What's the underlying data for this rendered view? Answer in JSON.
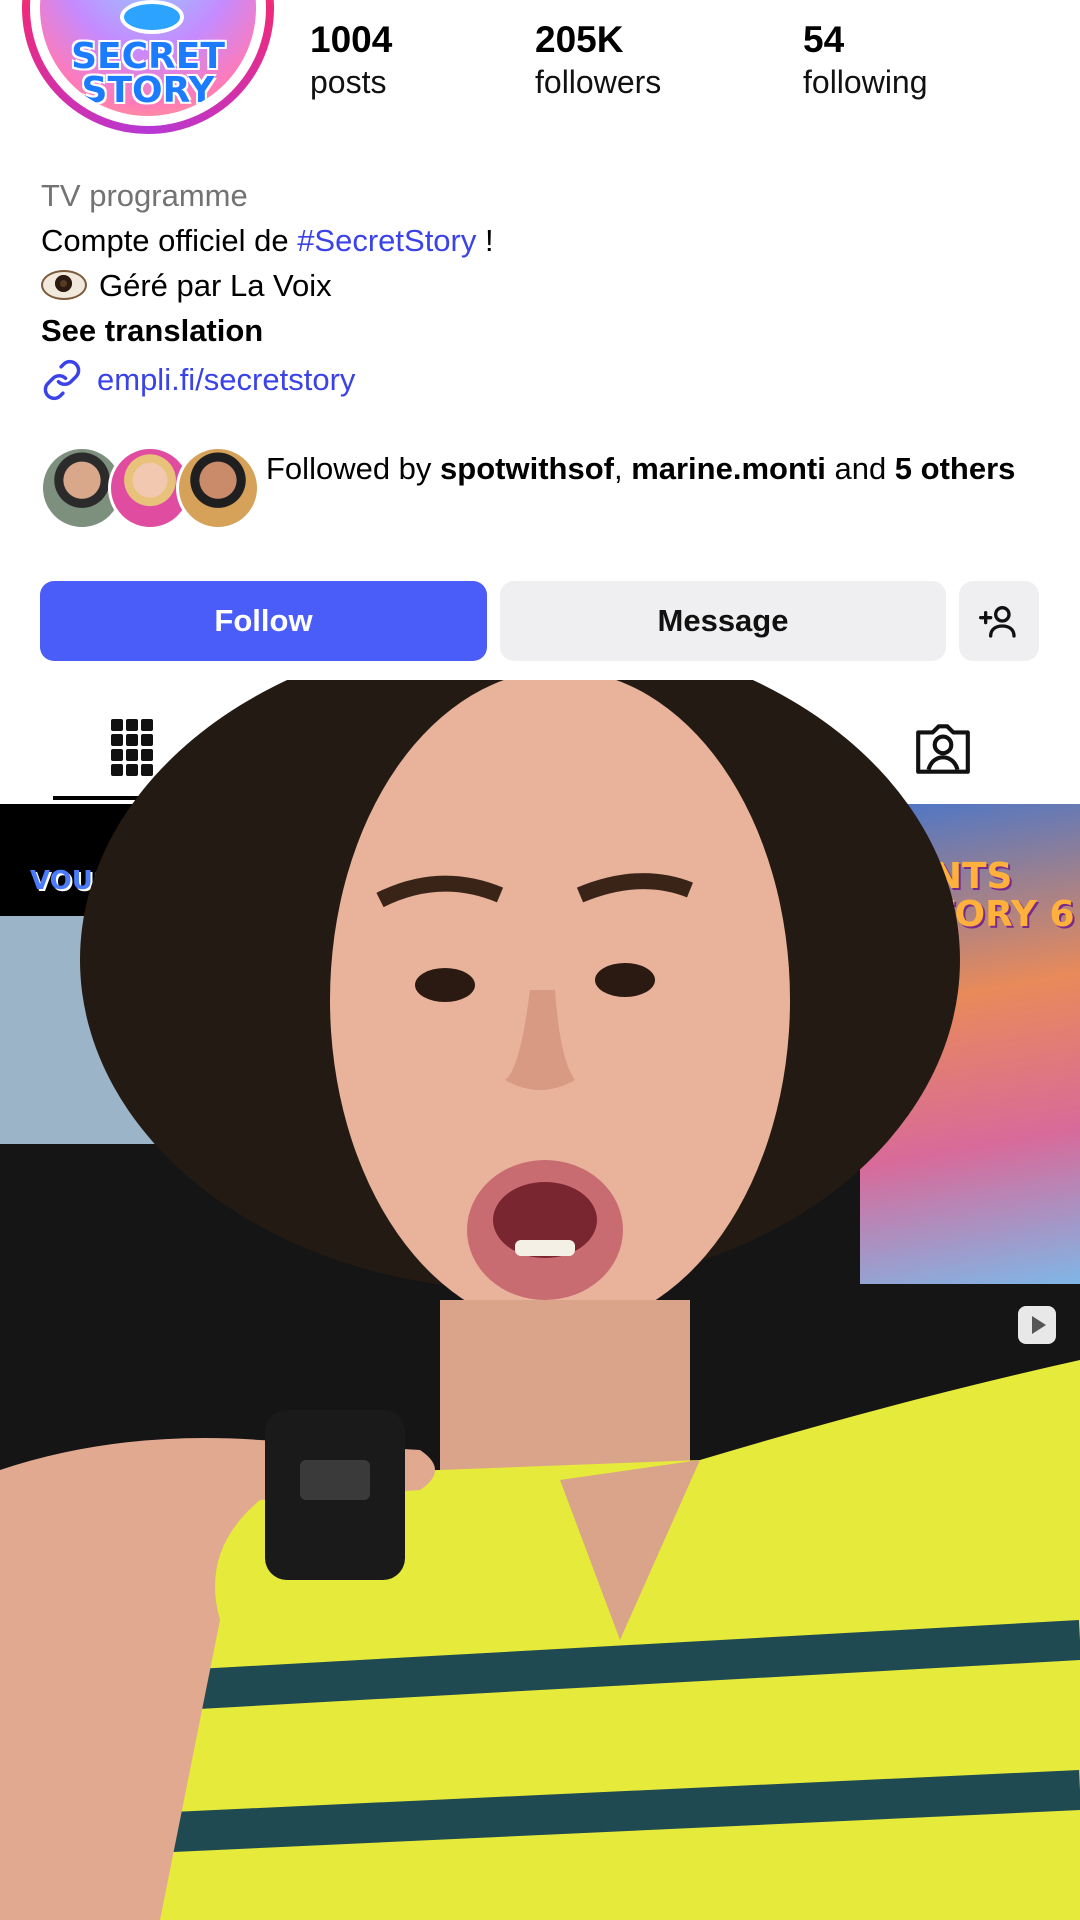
{
  "profile": {
    "logo_text": "SECRET STORY",
    "stats": {
      "posts_count": "1004",
      "posts_label": "posts",
      "followers_count": "205K",
      "followers_label": "followers",
      "following_count": "54",
      "following_label": "following"
    },
    "category": "TV programme",
    "bio_prefix": "Compte officiel de ",
    "bio_hashtag": "#SecretStory",
    "bio_suffix": " !",
    "bio_line2": "Géré par La Voix",
    "see_translation": "See translation",
    "link": "empli.fi/secretstory",
    "followed_by_prefix": "Followed by ",
    "followed_by_user1": "spotwithsof",
    "followed_by_sep": ", ",
    "followed_by_user2": "marine.monti",
    "followed_by_and": " and ",
    "followed_by_others": "5 others"
  },
  "actions": {
    "follow_label": "Follow",
    "message_label": "Message"
  },
  "posts": {
    "tile_left_text": "VOUS L",
    "tile_right_text": "ANTS STORY 6"
  },
  "icons": [
    "link-icon",
    "add-user-icon",
    "grid-icon",
    "tagged-icon",
    "play-icon",
    "eye-emoji-icon"
  ],
  "colors": {
    "accent_blue": "#4a5df9",
    "link_blue": "#3b43e8",
    "secondary_button": "#efeff1",
    "category_gray": "#737373"
  }
}
